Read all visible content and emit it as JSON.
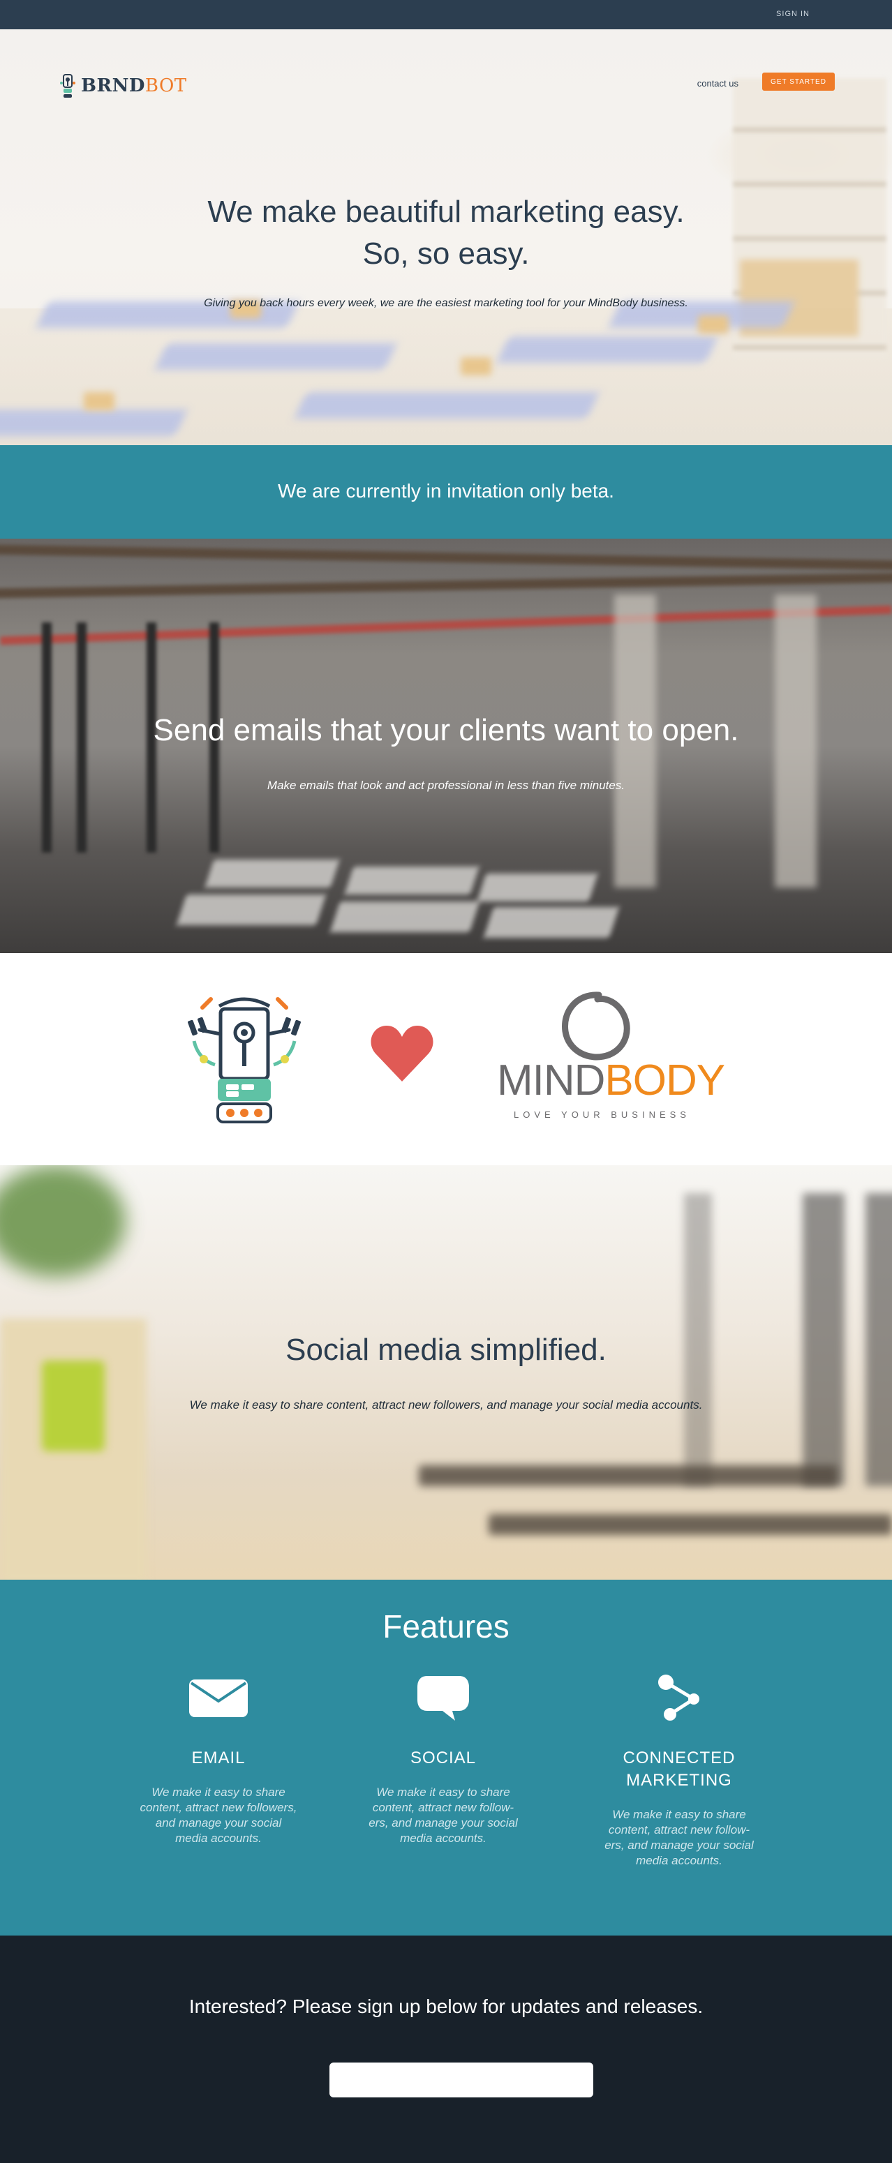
{
  "topbar": {
    "signin_label": "SIGN IN"
  },
  "nav": {
    "logo_bold": "BRND",
    "logo_light": "BOT",
    "contact_label": "contact us",
    "cta_label": "GET STARTED"
  },
  "hero": {
    "title_line1": "We make beautiful marketing easy.",
    "title_line2": "So, so easy.",
    "subtitle": "Giving you back hours every week, we are the easiest marketing tool for your MindBody business."
  },
  "beta": {
    "text": "We are currently in invitation only beta."
  },
  "emails_section": {
    "title": "Send emails that your clients want to open.",
    "subtitle": "Make emails that look and act professional in less than five minutes."
  },
  "partner": {
    "mindbody_mind": "MIND",
    "mindbody_body": "BODY",
    "mindbody_tagline": "LOVE YOUR BUSINESS",
    "colors": {
      "heart": "#e05a55",
      "mindbody_orange": "#f08a1d",
      "mindbody_gray": "#6b6a6c"
    }
  },
  "social_section": {
    "title": "Social media simplified.",
    "subtitle": "We make it easy to share content, attract new followers, and manage your social media accounts."
  },
  "features": {
    "title": "Features",
    "items": [
      {
        "icon": "envelope-icon",
        "title": "EMAIL",
        "text": "We make it easy to share content, attract new followers, and manage your social media accounts."
      },
      {
        "icon": "speech-bubble-icon",
        "title": "SOCIAL",
        "text": "We make it easy to share content, attract new follow-ers, and manage your social media accounts."
      },
      {
        "icon": "share-nodes-icon",
        "title": "CONNECTED MARKETING",
        "text": "We make it easy to share content, attract new follow-ers, and manage your social media accounts."
      }
    ]
  },
  "signup": {
    "title": "Interested? Please sign up below for updates and releases.",
    "email_value": "",
    "email_placeholder": ""
  },
  "theme": {
    "navy": "#2c3e50",
    "teal": "#2e8c9f",
    "orange": "#ef7b28",
    "dark": "#18212a"
  }
}
